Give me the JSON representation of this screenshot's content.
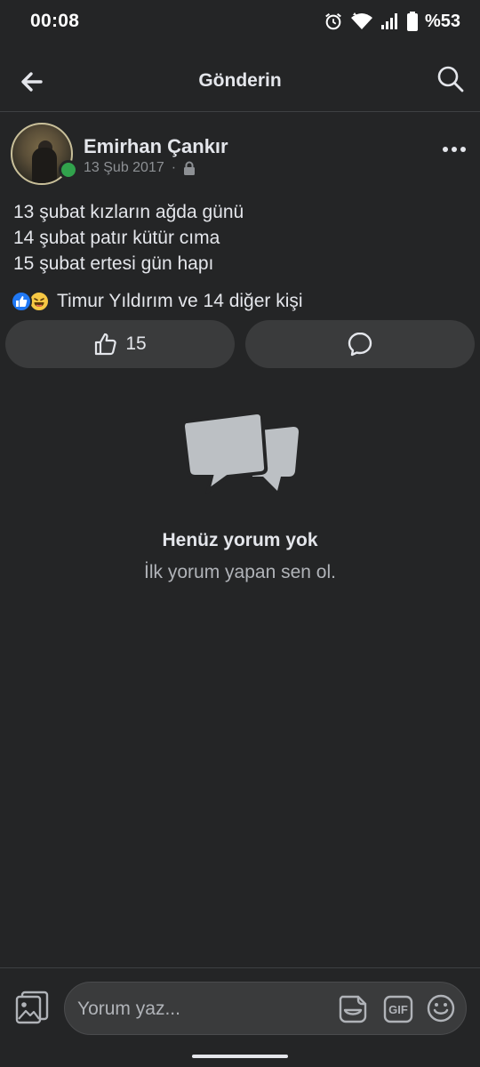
{
  "status_bar": {
    "time": "00:08",
    "battery": "%53",
    "icons": [
      "alarm-icon",
      "wifi-icon",
      "signal-icon",
      "battery-icon"
    ]
  },
  "app_bar": {
    "title": "Gönderin",
    "back_icon": "arrow-left-icon",
    "search_icon": "search-icon"
  },
  "post": {
    "author": "Emirhan Çankır",
    "date": "13 Şub 2017",
    "separator": "·",
    "privacy_icon": "lock-icon",
    "online": true,
    "lines": [
      "13 şubat kızların ağda günü",
      "14 şubat patır kütür cıma",
      "15 şubat ertesi gün hapı"
    ],
    "reactions_text": "Timur Yıldırım ve 14 diğer kişi",
    "reaction_types": [
      "like",
      "haha"
    ],
    "like_count": "15"
  },
  "empty_state": {
    "title": "Henüz yorum yok",
    "subtitle": "İlk yorum yapan sen ol."
  },
  "composer": {
    "placeholder": "Yorum yaz...",
    "gif_label": "GIF"
  },
  "colors": {
    "background": "#242526",
    "surface": "#3a3b3c",
    "text": "#e4e6eb",
    "secondary_text": "#b0b3b8",
    "like_blue": "#2078f4",
    "online_green": "#31a24c"
  }
}
